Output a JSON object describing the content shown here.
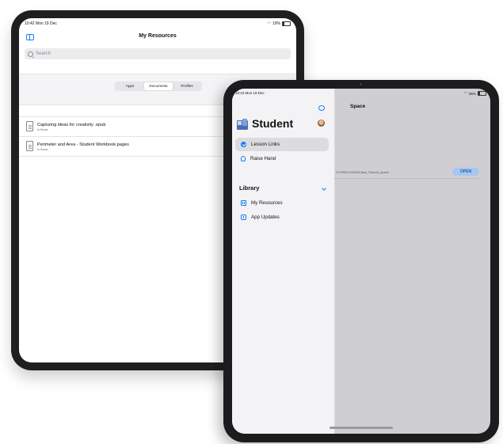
{
  "back_ipad": {
    "status": {
      "time": "10:42 Mon 19 Dec",
      "battery": "19%"
    },
    "title": "My Resources",
    "search_placeholder": "Search",
    "tabs": [
      "Apps",
      "Documents",
      "Profiles"
    ],
    "active_tab": "Documents",
    "documents": [
      {
        "name": "Capturing ideas for creativity .epub",
        "source": "In House"
      },
      {
        "name": "Perimeter and Area - Student Workbook.pages",
        "source": "In House"
      }
    ]
  },
  "front_ipad": {
    "status": {
      "time": "10:23 Mon 19 Dec",
      "battery": "95%"
    },
    "app_title": "Student",
    "menu": [
      {
        "label": "Lesson Links",
        "icon": "lesson-links-icon",
        "selected": true
      },
      {
        "label": "Raise Hand",
        "icon": "raise-hand-icon",
        "selected": false
      }
    ],
    "library_header": "Library",
    "library_items": [
      {
        "label": "My Resources",
        "icon": "my-resources-icon"
      },
      {
        "label": "App Updates",
        "icon": "app-updates-icon"
      }
    ],
    "detail": {
      "title": "Space",
      "path": "//THINKCOAGNClass_Shared_space",
      "open_label": "OPEN"
    }
  },
  "colors": {
    "accent": "#1a7cf6",
    "open_button_bg": "#a8c6ee"
  }
}
